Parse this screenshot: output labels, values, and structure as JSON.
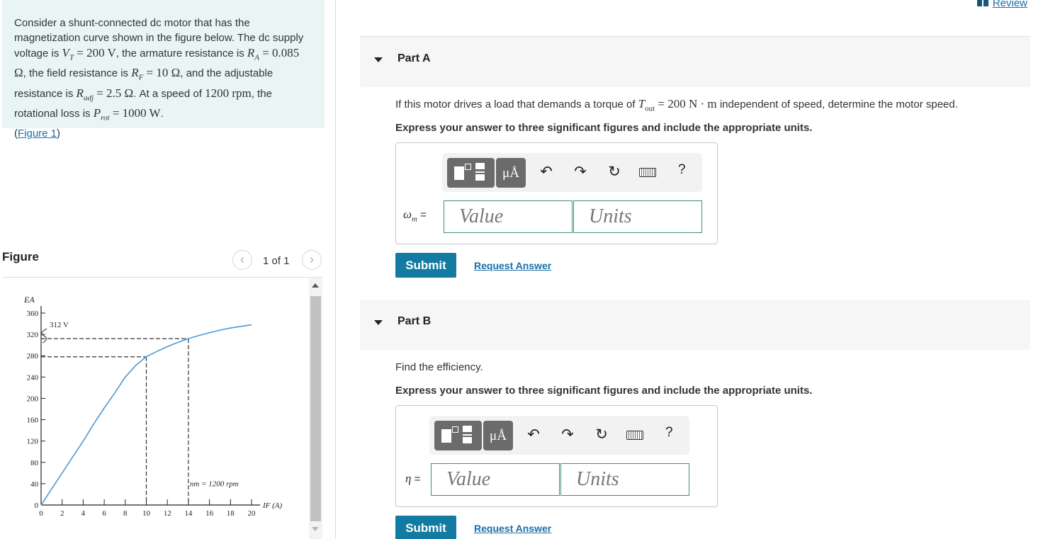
{
  "problem": {
    "t1": "Consider a shunt-connected dc motor that has the magnetization curve shown in the figure below. The dc supply voltage is",
    "vt_sym": "V",
    "vt_sub": "T",
    "vt_val": "= 200 V",
    "t2": ", the armature resistance is",
    "ra_sym": "R",
    "ra_sub": "A",
    "ra_val": "= 0.085 Ω",
    "t3": ", the field resistance is",
    "rf_sym": "R",
    "rf_sub": "F",
    "rf_val": "= 10 Ω",
    "t4": ", and the adjustable resistance is",
    "radj_sym": "R",
    "radj_sub": "adj",
    "radj_val": "= 2.5 Ω",
    "t5": ". At a speed of",
    "speed": "1200 rpm",
    "t6": ", the rotational loss is",
    "prot_sym": "P",
    "prot_sub": "rot",
    "prot_val": "= 1000 W",
    "t7": ".",
    "figure_link": "Figure 1"
  },
  "figure_panel": {
    "title": "Figure",
    "pager": "1 of 1",
    "prev_icon": "chevron-left-icon",
    "next_icon": "chevron-right-icon"
  },
  "review": {
    "label": "Review",
    "icon": "book-icon"
  },
  "parts": {
    "a": {
      "title": "Part A",
      "q_pre": "If this motor drives a load that demands a torque of",
      "q_sym": "T",
      "q_sub": "out",
      "q_val": "= 200 N · m",
      "q_post": "independent of speed, determine the motor speed.",
      "instruction": "Express your answer to three significant figures and include the appropriate units.",
      "var_sym": "ω",
      "var_sub": "m",
      "var_eq": " =",
      "value_placeholder": "Value",
      "units_placeholder": "Units",
      "submit": "Submit",
      "request": "Request Answer"
    },
    "b": {
      "title": "Part B",
      "question": "Find the efficiency.",
      "instruction": "Express your answer to three significant figures and include the appropriate units.",
      "var_sym": "η",
      "var_eq": " =",
      "value_placeholder": "Value",
      "units_placeholder": "Units",
      "submit": "Submit",
      "request": "Request Answer"
    }
  },
  "toolbar": {
    "mu": "μÅ",
    "undo": "↶",
    "redo": "↷",
    "reset": "↻",
    "help": "?"
  },
  "chart_data": {
    "type": "line",
    "ylabel": "E_A",
    "xlabel": "I_F (A)",
    "x_ticks": [
      "0",
      "2",
      "4",
      "6",
      "8",
      "10",
      "12",
      "14",
      "16",
      "18",
      "20"
    ],
    "y_ticks": [
      "0",
      "40",
      "80",
      "120",
      "160",
      "200",
      "240",
      "280",
      "320",
      "360"
    ],
    "xlim": [
      0,
      20
    ],
    "ylim": [
      0,
      360
    ],
    "series": [
      {
        "x": [
          0,
          1,
          2,
          3,
          4,
          5,
          6,
          7,
          8,
          9,
          10,
          11,
          12,
          13,
          14,
          15,
          16,
          17,
          18,
          19,
          20
        ],
        "y": [
          0,
          30,
          60,
          90,
          120,
          152,
          182,
          210,
          240,
          262,
          278,
          288,
          297,
          305,
          312,
          318,
          323,
          328,
          332,
          335,
          338
        ]
      }
    ],
    "annotations": {
      "break_label": "312 V",
      "break_value": 312,
      "speed_label": "n_m = 1200 rpm",
      "dashed_points": [
        {
          "x": 10,
          "y": 278
        },
        {
          "x": 14,
          "y": 312
        }
      ]
    }
  }
}
